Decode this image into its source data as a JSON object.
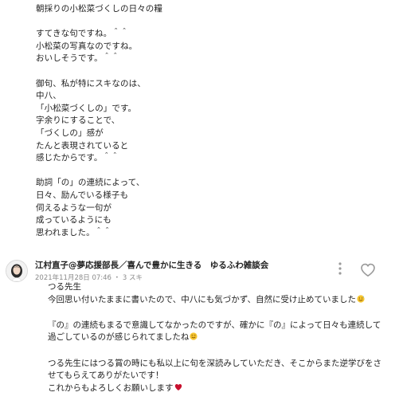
{
  "post": {
    "lines": [
      "朝採りの小松菜づくしの日々の糧",
      "",
      "すてきな句ですね。＾＾",
      "小松菜の写真なのですね。",
      "おいしそうです。＾＾",
      "",
      "御句、私が特にスキなのは、",
      "中八、",
      "「小松菜づくしの」です。",
      "字余りにすることで、",
      "「づくしの」感が",
      "たんと表現されていると",
      "感じたからです。＾＾",
      "",
      "助詞「の」の連続によって、",
      "日々、励んでいる様子も",
      "伺えるような一句が",
      "成っているようにも",
      "思われました。＾＾"
    ]
  },
  "comment": {
    "author": "江村直子@夢応援部長／喜んで豊かに生きる　ゆるふわ雑談会",
    "date": "2021年11月28日 07:46",
    "separator": "・",
    "likes": "3 スキ",
    "avatar_icon": "author-avatar",
    "more_icon": "more-vertical-icon",
    "like_icon": "heart-outline-icon",
    "lines": [
      "つる先生",
      "今回思い付いたままに書いたので、中八にも気づかず、自然に受け止めていました",
      "",
      "『の』の連続もまるで意識してなかったのですが、確かに『の』によって日々も連続して",
      "過ごしているのが感じられてましたね",
      "",
      "つる先生にはつる賞の時にも私以上に句を深読みしていただき、そこからまた逆学びをさ",
      "せてもらえてありがたいです！",
      "これからもよろしくお願いします"
    ],
    "emoji_names": [
      "sweat-smile-emoji",
      "smile-emoji",
      "heart-emoji"
    ]
  },
  "colors": {
    "text": "#222222",
    "meta": "#8a8a8a",
    "icon": "#9a9a9a",
    "heart_emoji": "#c8102e",
    "smile_emoji": "#f4c430"
  }
}
